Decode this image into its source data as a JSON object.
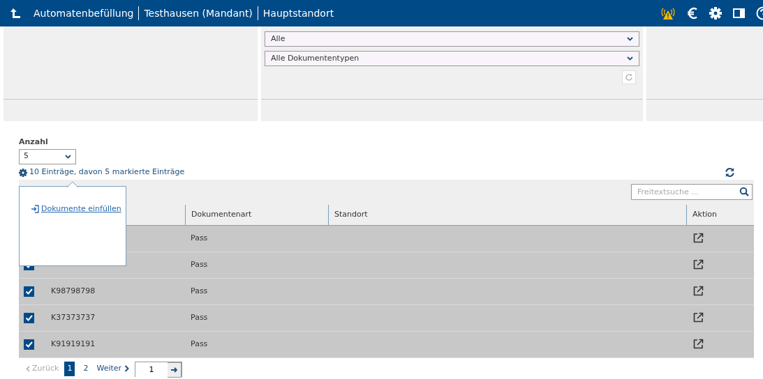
{
  "header": {
    "crumbs": [
      "Automatenbefüllung",
      "Testhausen (Mandant)",
      "Hauptstandort"
    ]
  },
  "filters": [
    {
      "value": "Alle"
    },
    {
      "value": "Alle Dokumententypen"
    }
  ],
  "count": {
    "label": "Anzahl",
    "value": "5"
  },
  "summary": "10 Einträge, davon 5 markierte Einträge",
  "popover": {
    "action": "Dokumente einfüllen"
  },
  "search": {
    "placeholder": "Freitextsuche ..."
  },
  "table": {
    "columns": [
      "Dokumentenart",
      "Standort",
      "Aktion"
    ],
    "rows": [
      {
        "type": "Pass"
      },
      {
        "type": "Pass",
        "checked": true
      },
      {
        "id": "K98798798",
        "type": "Pass",
        "checked": true
      },
      {
        "id": "K37373737",
        "type": "Pass",
        "checked": true
      },
      {
        "id": "K91919191",
        "type": "Pass",
        "checked": true
      }
    ]
  },
  "pagination": {
    "prev": "Zurück",
    "pages": [
      {
        "label": "1",
        "selected": true
      },
      {
        "label": "2",
        "selected": false
      }
    ],
    "next": "Weiter",
    "page_input": "1"
  }
}
